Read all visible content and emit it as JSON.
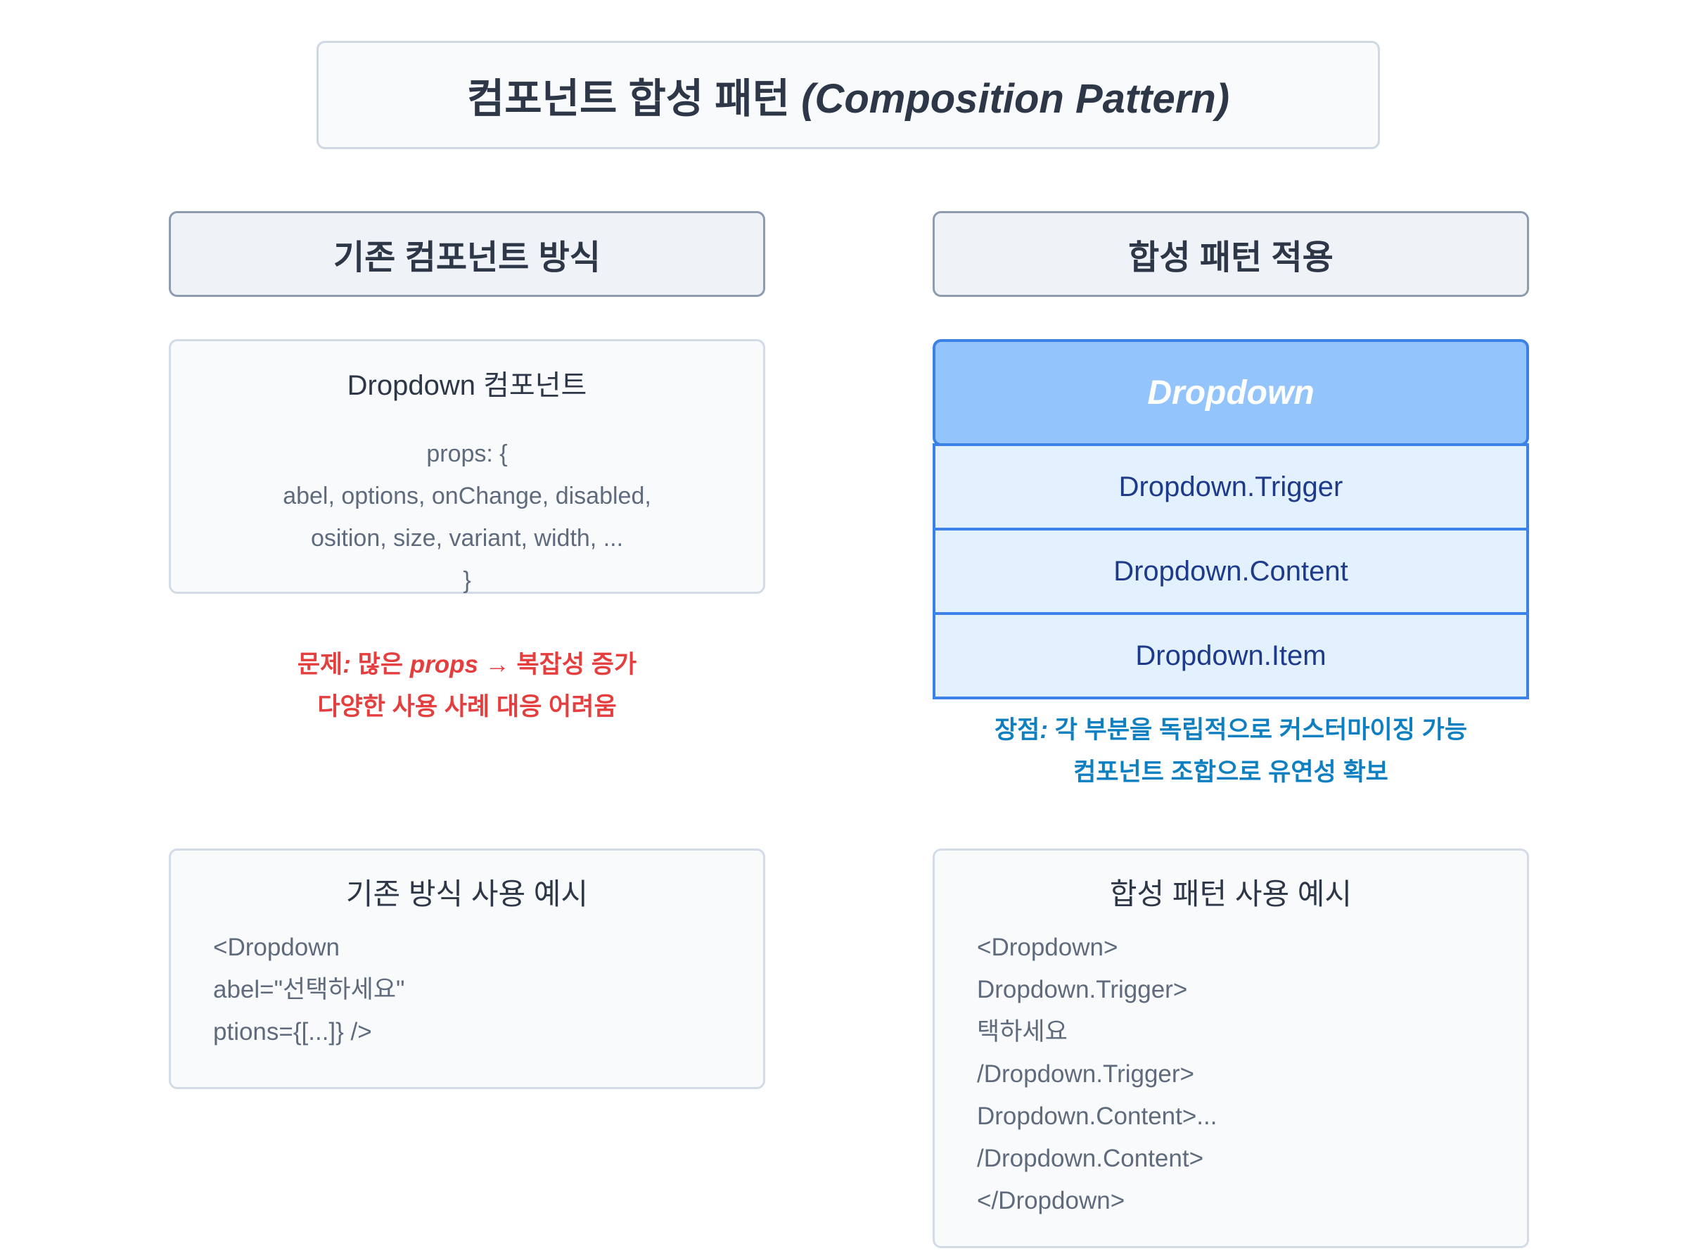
{
  "title": {
    "ko": "컴포넌트 합성 패턴 ",
    "en": "(Composition Pattern)"
  },
  "headers": {
    "left": "기존 컴포넌트 방식",
    "right": "합성 패턴 적용"
  },
  "legacy_component": {
    "title": "Dropdown 컴포넌트",
    "code_lines": [
      "props: {",
      "abel, options, onChange, disabled,",
      "osition, size, variant, width, ...",
      "}"
    ]
  },
  "problem": {
    "line1_prefix": "문제",
    "line1_colon": ": ",
    "line1_mid": "많은 ",
    "line1_props": "props",
    "line1_suffix": " → 복잡성 증가",
    "line2": "다양한 사용 사례 대응 어려움"
  },
  "composition": {
    "root": "Dropdown",
    "children": [
      "Dropdown.Trigger",
      "Dropdown.Content",
      "Dropdown.Item"
    ]
  },
  "benefit": {
    "line1_prefix": "장점",
    "line1_colon": ": ",
    "line1_rest": "각 부분을 독립적으로 커스터마이징 가능",
    "line2": "컴포넌트 조합으로 유연성 확보"
  },
  "legacy_example": {
    "title": "기존 방식 사용 예시",
    "code_lines": [
      "<Dropdown",
      "abel=\"선택하세요\"",
      "ptions={[...]} />"
    ]
  },
  "composition_example": {
    "title": "합성 패턴 사용 예시",
    "code_lines": [
      "<Dropdown>",
      "Dropdown.Trigger>",
      "택하세요",
      "/Dropdown.Trigger>",
      "Dropdown.Content>...",
      "/Dropdown.Content>",
      "</Dropdown>"
    ]
  }
}
